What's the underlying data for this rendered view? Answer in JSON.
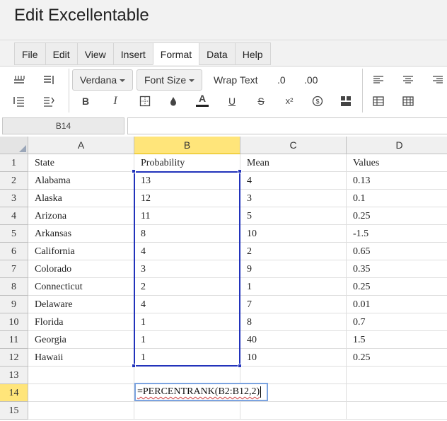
{
  "app": {
    "title": "Edit Excellentable"
  },
  "menu": [
    {
      "label": "File",
      "active": false
    },
    {
      "label": "Edit",
      "active": false
    },
    {
      "label": "View",
      "active": false
    },
    {
      "label": "Insert",
      "active": false
    },
    {
      "label": "Format",
      "active": true
    },
    {
      "label": "Data",
      "active": false
    },
    {
      "label": "Help",
      "active": false
    }
  ],
  "toolbar": {
    "font_family": "Verdana",
    "font_size_label": "Font Size",
    "wrap_text_label": "Wrap Text",
    "decrease_decimal_label": ".0",
    "increase_decimal_label": ".00",
    "bold_label": "B",
    "italic_label": "I",
    "text_color_label": "A",
    "underline_label": "U",
    "strike_label": "S",
    "superscript_label": "x²",
    "currency_label": "$",
    "text_color_bar": "#222222"
  },
  "formula_bar": {
    "cell_ref": "B14",
    "value": ""
  },
  "grid": {
    "columns": [
      "A",
      "B",
      "C",
      "D"
    ],
    "selected_column": "B",
    "selected_row": "14",
    "row_numbers": [
      "1",
      "2",
      "3",
      "4",
      "5",
      "6",
      "7",
      "8",
      "9",
      "10",
      "11",
      "12",
      "13",
      "14",
      "15"
    ],
    "rows": [
      [
        "State",
        "Probability",
        "Mean",
        "Values"
      ],
      [
        "Alabama",
        "13",
        "4",
        "0.13"
      ],
      [
        "Alaska",
        "12",
        "3",
        "0.1"
      ],
      [
        "Arizona",
        "11",
        "5",
        "0.25"
      ],
      [
        "Arkansas",
        "8",
        "10",
        "-1.5"
      ],
      [
        "California",
        "4",
        "2",
        "0.65"
      ],
      [
        "Colorado",
        "3",
        "9",
        "0.35"
      ],
      [
        "Connecticut",
        "2",
        "1",
        "0.25"
      ],
      [
        "Delaware",
        "4",
        "7",
        "0.01"
      ],
      [
        "Florida",
        "1",
        "8",
        "0.7"
      ],
      [
        "Georgia",
        "1",
        "40",
        "1.5"
      ],
      [
        "Hawaii",
        "1",
        "10",
        "0.25"
      ],
      [
        "",
        "",
        "",
        ""
      ],
      [
        "",
        "",
        "",
        ""
      ],
      [
        "",
        "",
        "",
        ""
      ]
    ],
    "selected_range": "B2:B12",
    "editing_cell": "B14",
    "editing_formula": "=PERCENTRANK(B2:B12,2)"
  },
  "colors": {
    "selection": "#2233bb",
    "header_highlight": "#ffe57a",
    "editor_border": "#7ba3e0"
  }
}
